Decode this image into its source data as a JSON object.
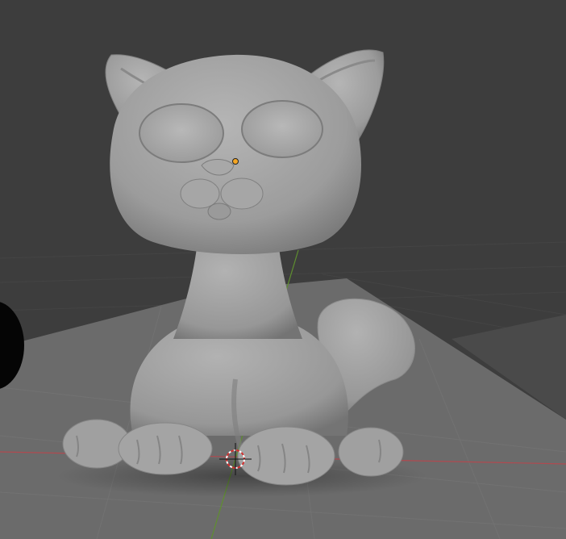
{
  "viewport": {
    "background": "#3d3d3d",
    "grid_color": "#464646",
    "floor_color": "#6b6b6b",
    "x_axis_color": "#b04a50",
    "y_axis_color": "#5f8f2f",
    "model_color": "#a3a3a3",
    "origin_color": "#f5a623"
  },
  "scene": {
    "model": "cat-sculpt",
    "cursor": "3d-cursor-icon",
    "origin": "object-origin-dot"
  }
}
